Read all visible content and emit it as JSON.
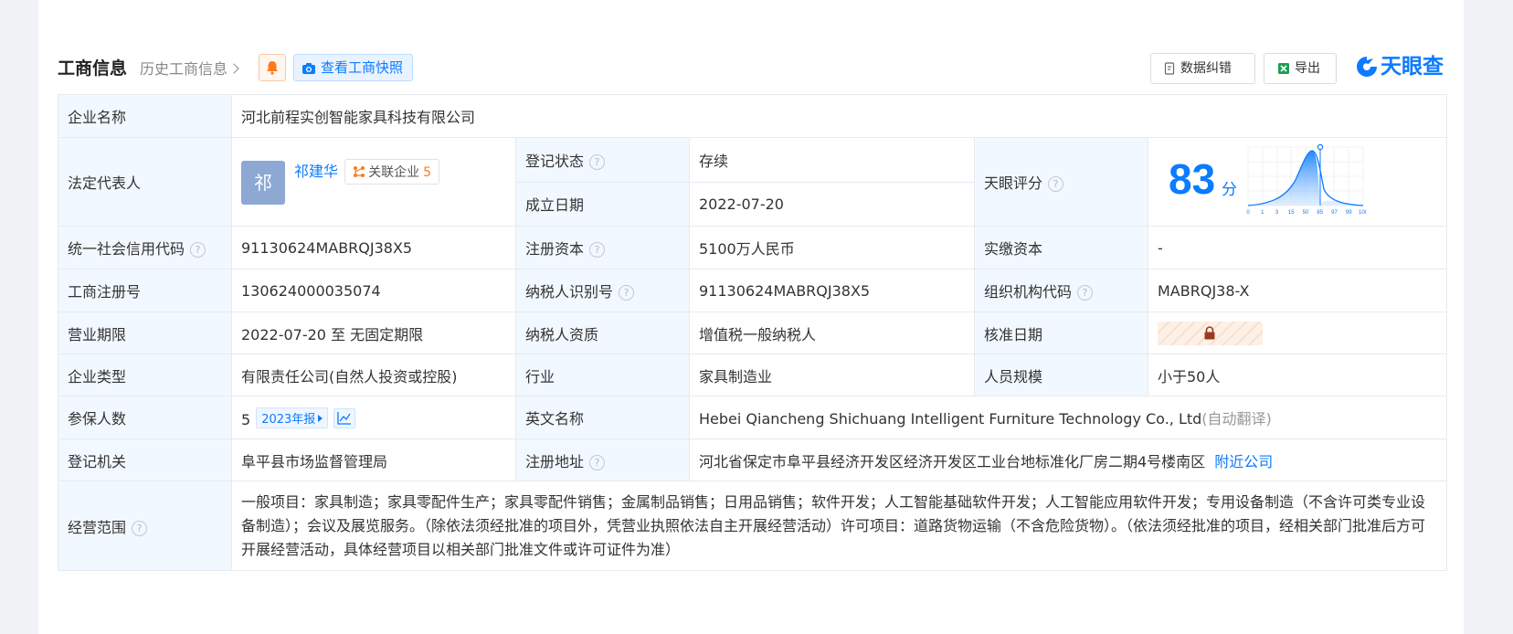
{
  "header": {
    "title": "工商信息",
    "history_link": "历史工商信息",
    "snapshot_button": "查看工商快照",
    "fix_button": "数据纠错",
    "export_button": "导出",
    "logo_text": "天眼查"
  },
  "colors": {
    "accent": "#0b7bff",
    "status_green": "#13a14a",
    "key_bg": "#f2f8ff",
    "count_orange": "#ff7a1a"
  },
  "rows": {
    "company_name": {
      "label": "企业名称",
      "value": "河北前程实创智能家具科技有限公司"
    },
    "legal_rep": {
      "label": "法定代表人",
      "avatar_char": "祁",
      "name": "祁建华",
      "related_label": "关联企业",
      "related_count": "5"
    },
    "reg_status": {
      "label": "登记状态",
      "value": "存续"
    },
    "found_date": {
      "label": "成立日期",
      "value": "2022-07-20"
    },
    "tianyan_score": {
      "label": "天眼评分",
      "score": "83",
      "unit": "分",
      "chart_ticks": [
        "0",
        "1",
        "3",
        "15",
        "50",
        "85",
        "97",
        "99",
        "100"
      ]
    },
    "credit_code": {
      "label": "统一社会信用代码",
      "value": "91130624MABRQJ38X5"
    },
    "reg_capital": {
      "label": "注册资本",
      "value": "5100万人民币"
    },
    "paid_capital": {
      "label": "实缴资本",
      "value": "-"
    },
    "reg_no": {
      "label": "工商注册号",
      "value": "130624000035074"
    },
    "taxpayer_id": {
      "label": "纳税人识别号",
      "value": "91130624MABRQJ38X5"
    },
    "org_code": {
      "label": "组织机构代码",
      "value": "MABRQJ38-X"
    },
    "term": {
      "label": "营业期限",
      "value": "2022-07-20 至 无固定期限"
    },
    "taxpayer_qual": {
      "label": "纳税人资质",
      "value": "增值税一般纳税人"
    },
    "approve_date": {
      "label": "核准日期"
    },
    "company_type": {
      "label": "企业类型",
      "value": "有限责任公司(自然人投资或控股)"
    },
    "industry": {
      "label": "行业",
      "value": "家具制造业"
    },
    "staff_size": {
      "label": "人员规模",
      "value": "小于50人"
    },
    "insured": {
      "label": "参保人数",
      "value": "5",
      "report_tag": "2023年报"
    },
    "english_name": {
      "label": "英文名称",
      "value": "Hebei Qiancheng Shichuang Intelligent Furniture Technology Co., Ltd",
      "note": "(自动翻译)"
    },
    "reg_authority": {
      "label": "登记机关",
      "value": "阜平县市场监督管理局"
    },
    "reg_address": {
      "label": "注册地址",
      "value": "河北省保定市阜平县经济开发区经济开发区工业台地标准化厂房二期4号楼南区",
      "nearby_link": "附近公司"
    },
    "scope": {
      "label": "经营范围",
      "value": "一般项目：家具制造；家具零配件生产；家具零配件销售；金属制品销售；日用品销售；软件开发；人工智能基础软件开发；人工智能应用软件开发；专用设备制造（不含许可类专业设备制造）；会议及展览服务。（除依法须经批准的项目外，凭营业执照依法自主开展经营活动）许可项目：道路货物运输（不含危险货物）。（依法须经批准的项目，经相关部门批准后方可开展经营活动，具体经营项目以相关部门批准文件或许可证件为准）"
    }
  }
}
